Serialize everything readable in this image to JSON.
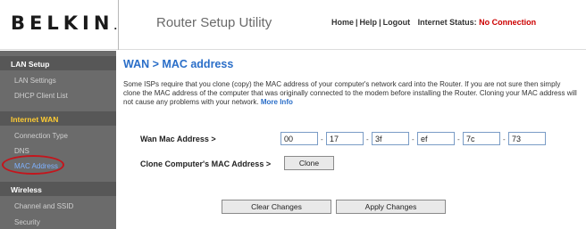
{
  "header": {
    "logo": "BELKIN",
    "logo_mark": ".",
    "app_title": "Router Setup Utility",
    "nav": {
      "home": "Home",
      "help": "Help",
      "logout": "Logout",
      "separator": "|"
    },
    "status_label": "Internet Status:",
    "status_value": "No Connection",
    "status_color": "#cc0000"
  },
  "sidebar": {
    "sections": [
      {
        "title": "LAN Setup",
        "items": [
          "LAN Settings",
          "DHCP Client List"
        ]
      },
      {
        "title": "Internet WAN",
        "items": [
          "Connection Type",
          "DNS",
          "MAC Address"
        ]
      },
      {
        "title": "Wireless",
        "items": [
          "Channel and SSID",
          "Security"
        ]
      }
    ],
    "active_item": "MAC Address"
  },
  "main": {
    "title": "WAN > MAC address",
    "description": "Some ISPs require that you clone (copy) the MAC address of your computer's network card into the Router. If you are not sure then simply clone the MAC address of the computer that was originally connected to the modem before installing the Router. Cloning your MAC address will not cause any problems with your network.",
    "more_info": "More Info",
    "wan_mac_label": "Wan Mac Address >",
    "mac_octets": [
      "00",
      "17",
      "3f",
      "ef",
      "7c",
      "73"
    ],
    "octet_separator": "-",
    "clone_label": "Clone Computer's MAC Address >",
    "clone_button": "Clone",
    "clear_button": "Clear Changes",
    "apply_button": "Apply Changes"
  },
  "colors": {
    "accent_blue": "#2a6ec8",
    "sidebar_bg": "#6b6b6b",
    "section_accent": "#ffcc33",
    "highlight_ring": "#c4151c"
  }
}
